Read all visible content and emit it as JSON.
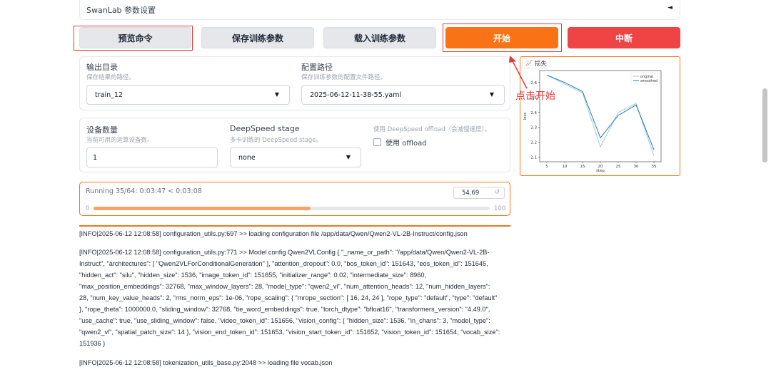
{
  "accordion": {
    "title": "SwanLab 参数设置",
    "caret": "◄"
  },
  "buttons": {
    "preview": "预览命令",
    "save": "保存训练参数",
    "load": "载入训练参数",
    "start": "开始",
    "stop": "中断"
  },
  "output_dir": {
    "label": "输出目录",
    "hint": "保存结果的路径。",
    "value": "train_12"
  },
  "config_path": {
    "label": "配置路径",
    "hint": "保存训练参数的配置文件路径。",
    "value": "2025-06-12-11-38-55.yaml"
  },
  "device_count": {
    "label": "设备数量",
    "hint": "当前可用的运算设备数。",
    "value": "1"
  },
  "deepspeed": {
    "label": "DeepSpeed stage",
    "hint": "多卡训练的 DeepSpeed stage。",
    "value": "none"
  },
  "offload": {
    "hint": "使用 DeepSpeed offload（会减慢速度）。",
    "label": "使用 offload",
    "checked": false
  },
  "progress": {
    "status": "Running 35/64: 0:03:47 < 0:03:08",
    "value": "54.69",
    "min": "0",
    "max": "100",
    "fraction": 0.5469
  },
  "chart_tag": "损失",
  "annotation": "点击开始",
  "chart_data": {
    "type": "line",
    "title": "",
    "xlabel": "step",
    "ylabel": "loss",
    "xlim": [
      3,
      37
    ],
    "ylim": [
      2.07,
      2.68
    ],
    "xticks": [
      5,
      10,
      15,
      20,
      25,
      30,
      35
    ],
    "yticks": [
      2.1,
      2.2,
      2.3,
      2.4,
      2.5,
      2.6
    ],
    "legend_position": "top-right",
    "series": [
      {
        "name": "original",
        "color": "#9ecae1",
        "x": [
          5,
          10,
          15,
          20,
          25,
          30,
          35
        ],
        "y": [
          2.65,
          2.59,
          2.53,
          2.17,
          2.4,
          2.46,
          2.11
        ]
      },
      {
        "name": "smoothed",
        "color": "#1f77b4",
        "x": [
          5,
          10,
          15,
          20,
          25,
          30,
          35
        ],
        "y": [
          2.65,
          2.6,
          2.54,
          2.23,
          2.38,
          2.45,
          2.15
        ]
      }
    ]
  },
  "logs": [
    "[INFO|2025-06-12 12:08:58] configuration_utils.py:697 >> loading configuration file /app/data/Qwen/Qwen2-VL-2B-Instruct/config.json",
    "[INFO|2025-06-12 12:08:58] configuration_utils.py:771 >> Model config Qwen2VLConfig { \"_name_or_path\": \"/app/data/Qwen/Qwen2-VL-2B-",
    "Instruct\", \"architectures\": [ \"Qwen2VLForConditionalGeneration\" ], \"attention_dropout\": 0.0, \"bos_token_id\": 151643, \"eos_token_id\": 151645,",
    "\"hidden_act\": \"silu\", \"hidden_size\": 1536, \"image_token_id\": 151655, \"initializer_range\": 0.02, \"intermediate_size\": 8960,",
    "\"max_position_embeddings\": 32768, \"max_window_layers\": 28, \"model_type\": \"qwen2_vl\", \"num_attention_heads\": 12, \"num_hidden_layers\":",
    "28, \"num_key_value_heads\": 2, \"rms_norm_eps\": 1e-06, \"rope_scaling\": { \"mrope_section\": [ 16, 24, 24 ], \"rope_type\": \"default\", \"type\": \"default\"",
    "}, \"rope_theta\": 1000000.0, \"sliding_window\": 32768, \"tie_word_embeddings\": true, \"torch_dtype\": \"bfloat16\", \"transformers_version\": \"4.49.0\",",
    "\"use_cache\": true, \"use_sliding_window\": false, \"video_token_id\": 151656, \"vision_config\": { \"hidden_size\": 1536, \"in_chans\": 3, \"model_type\":",
    "\"qwen2_vl\", \"spatial_patch_size\": 14 }, \"vision_end_token_id\": 151653, \"vision_start_token_id\": 151652, \"vision_token_id\": 151654, \"vocab_size\":",
    "151936 }",
    "[INFO|2025-06-12 12:08:58] tokenization_utils_base.py:2048 >> loading file vocab.json"
  ]
}
